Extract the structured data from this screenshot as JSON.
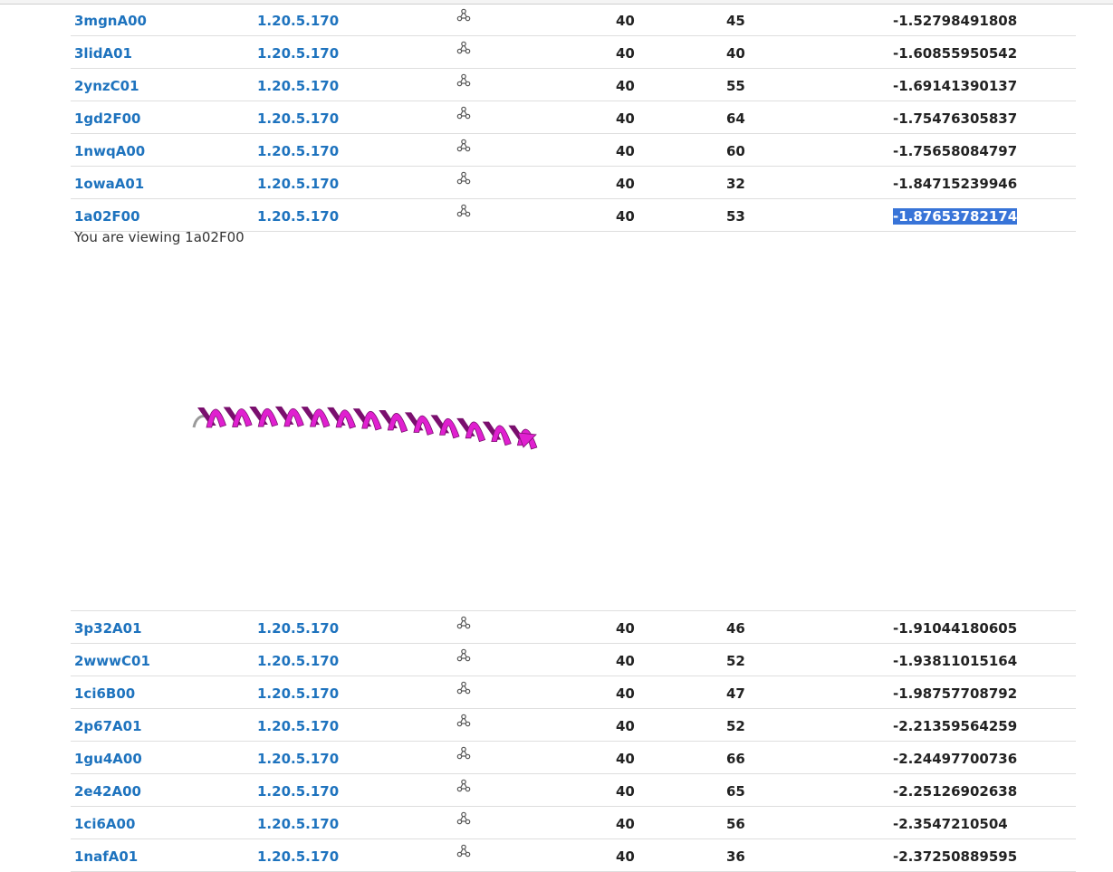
{
  "table_top": [
    {
      "domain": "3mgnA00",
      "class": "1.20.5.170",
      "col_a": "40",
      "col_b": "45",
      "score": "-1.52798491808"
    },
    {
      "domain": "3lidA01",
      "class": "1.20.5.170",
      "col_a": "40",
      "col_b": "40",
      "score": "-1.60855950542"
    },
    {
      "domain": "2ynzC01",
      "class": "1.20.5.170",
      "col_a": "40",
      "col_b": "55",
      "score": "-1.69141390137"
    },
    {
      "domain": "1gd2F00",
      "class": "1.20.5.170",
      "col_a": "40",
      "col_b": "64",
      "score": "-1.75476305837"
    },
    {
      "domain": "1nwqA00",
      "class": "1.20.5.170",
      "col_a": "40",
      "col_b": "60",
      "score": "-1.75658084797"
    },
    {
      "domain": "1owaA01",
      "class": "1.20.5.170",
      "col_a": "40",
      "col_b": "32",
      "score": "-1.84715239946"
    },
    {
      "domain": "1a02F00",
      "class": "1.20.5.170",
      "col_a": "40",
      "col_b": "53",
      "score": "-1.87653782174"
    }
  ],
  "viewing_text": "You are viewing 1a02F00",
  "viewer": {
    "helix_color": "#e020d0",
    "helix_dark_color": "#7a0f6e"
  },
  "table_bottom": [
    {
      "domain": "3p32A01",
      "class": "1.20.5.170",
      "col_a": "40",
      "col_b": "46",
      "score": "-1.91044180605"
    },
    {
      "domain": "2wwwC01",
      "class": "1.20.5.170",
      "col_a": "40",
      "col_b": "52",
      "score": "-1.93811015164"
    },
    {
      "domain": "1ci6B00",
      "class": "1.20.5.170",
      "col_a": "40",
      "col_b": "47",
      "score": "-1.98757708792"
    },
    {
      "domain": "2p67A01",
      "class": "1.20.5.170",
      "col_a": "40",
      "col_b": "52",
      "score": "-2.21359564259"
    },
    {
      "domain": "1gu4A00",
      "class": "1.20.5.170",
      "col_a": "40",
      "col_b": "66",
      "score": "-2.24497700736"
    },
    {
      "domain": "2e42A00",
      "class": "1.20.5.170",
      "col_a": "40",
      "col_b": "65",
      "score": "-2.25126902638"
    },
    {
      "domain": "1ci6A00",
      "class": "1.20.5.170",
      "col_a": "40",
      "col_b": "56",
      "score": "-2.3547210504"
    },
    {
      "domain": "1nafA01",
      "class": "1.20.5.170",
      "col_a": "40",
      "col_b": "36",
      "score": "-2.37250889595"
    }
  ],
  "icons": {
    "structure": "molecule-icon"
  },
  "colors": {
    "link": "#1e73be",
    "selection": "#3874d8",
    "helix": "#e020d0"
  }
}
